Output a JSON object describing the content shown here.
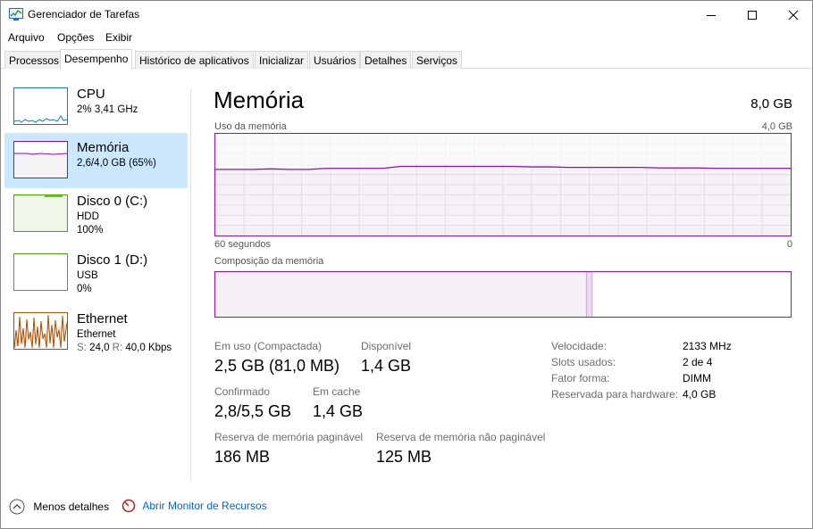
{
  "window": {
    "title": "Gerenciador de Tarefas",
    "controls": {
      "minimize": "minimize",
      "maximize": "maximize",
      "close": "close"
    }
  },
  "menu": {
    "file": "Arquivo",
    "options": "Opções",
    "view": "Exibir"
  },
  "tabs": [
    {
      "label": "Processos"
    },
    {
      "label": "Desempenho",
      "active": true
    },
    {
      "label": "Histórico de aplicativos"
    },
    {
      "label": "Inicializar"
    },
    {
      "label": "Usuários"
    },
    {
      "label": "Detalhes"
    },
    {
      "label": "Serviços"
    }
  ],
  "sidebar": {
    "items": [
      {
        "title": "CPU",
        "sub1": "2% 3,41 GHz"
      },
      {
        "title": "Memória",
        "sub1": "2,6/4,0 GB (65%)"
      },
      {
        "title": "Disco 0 (C:)",
        "sub1": "HDD",
        "sub2": "100%"
      },
      {
        "title": "Disco 1 (D:)",
        "sub1": "USB",
        "sub2": "0%"
      },
      {
        "title": "Ethernet",
        "sub1": "Ethernet",
        "sub2_s": "S:",
        "sub2_sv": "24,0",
        "sub2_r": "R:",
        "sub2_rv": "40,0 Kbps"
      }
    ]
  },
  "main": {
    "title": "Memória",
    "total": "8,0 GB",
    "usage_label": "Uso da memória",
    "usage_max": "4,0 GB",
    "time_label": "60 segundos",
    "time_end": "0",
    "composition_label": "Composição da memória"
  },
  "usage_graph": {
    "fraction_in_use": 0.65,
    "points": [
      0.65,
      0.65,
      0.65,
      0.655,
      0.65,
      0.65,
      0.66,
      0.66,
      0.66,
      0.66,
      0.68,
      0.68,
      0.68,
      0.68,
      0.68,
      0.68,
      0.68,
      0.675,
      0.675,
      0.67,
      0.67,
      0.67,
      0.67,
      0.67,
      0.665,
      0.665,
      0.665,
      0.66,
      0.66,
      0.66,
      0.66,
      0.66
    ],
    "composition": {
      "in_use": 0.645,
      "modified": 0.01,
      "standby": 0.0,
      "free": 0.345
    }
  },
  "stats": {
    "in_use_label": "Em uso (Compactada)",
    "in_use_value": "2,5 GB (81,0 MB)",
    "available_label": "Disponível",
    "available_value": "1,4 GB",
    "committed_label": "Confirmado",
    "committed_value": "2,8/5,5 GB",
    "cached_label": "Em cache",
    "cached_value": "1,4 GB",
    "paged_label": "Reserva de memória paginável",
    "paged_value": "186 MB",
    "nonpaged_label": "Reserva de memória não paginável",
    "nonpaged_value": "125 MB"
  },
  "specs": {
    "speed_label": "Velocidade:",
    "speed_value": "2133 MHz",
    "slots_label": "Slots usados:",
    "slots_value": "2 de 4",
    "form_label": "Fator forma:",
    "form_value": "DIMM",
    "reserved_label": "Reservada para hardware:",
    "reserved_value": "4,0 GB"
  },
  "footer": {
    "less_details": "Menos detalhes",
    "resource_monitor": "Abrir Monitor de Recursos"
  },
  "colors": {
    "memory_accent": "#8b12ae",
    "cpu_accent": "#117dbb",
    "disk_accent": "#4da60c",
    "ethernet_accent": "#a74f01",
    "selection": "#cce8ff",
    "link": "#0066cc"
  }
}
